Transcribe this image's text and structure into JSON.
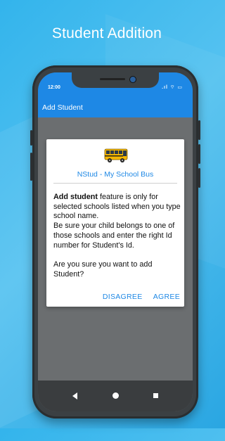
{
  "headline": "Student Addition",
  "status_bar": {
    "time": "12:00",
    "icons": ".ıl ⌔ ▭"
  },
  "app_bar": {
    "title": "Add Student"
  },
  "dialog": {
    "title": "NStud - My School Bus",
    "body_bold": "Add student",
    "body_line1": " feature is only for selected schools listed when you type school name.",
    "body_line2": "Be sure your child belongs to one of those schools and enter the right Id number for Student's Id.",
    "body_line3": "Are you sure you want to add Student?",
    "disagree_label": "DISAGREE",
    "agree_label": "AGREE"
  },
  "icons": {
    "bus": "school-bus-icon",
    "back": "back-icon",
    "home": "home-icon",
    "recent": "recent-apps-icon"
  },
  "colors": {
    "accent": "#1e88e5",
    "background": "#33b4ec"
  }
}
